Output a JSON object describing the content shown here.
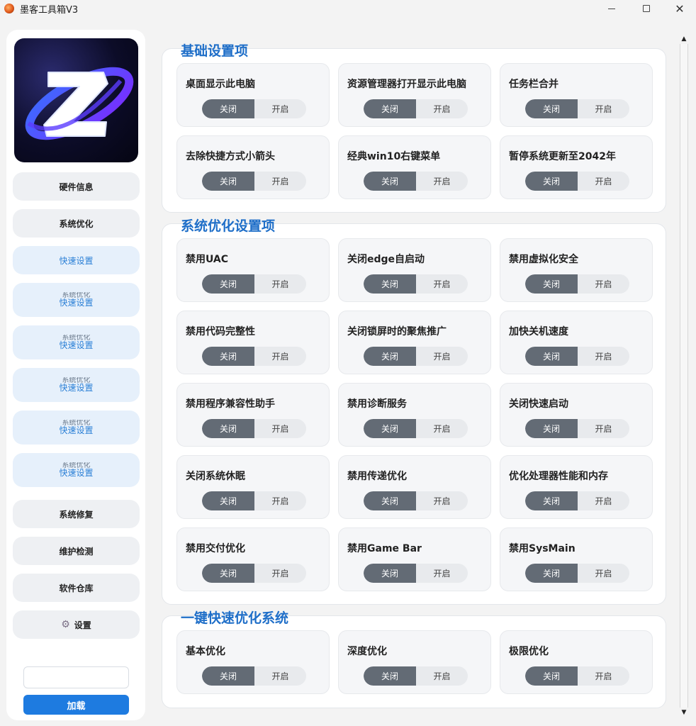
{
  "window": {
    "title": "墨客工具箱V3",
    "minimize_glyph": "",
    "close_glyph": "✕"
  },
  "sidebar": {
    "items": [
      {
        "label": "硬件信息"
      },
      {
        "label": "系统优化"
      },
      {
        "label": "快速设置"
      },
      {
        "label": "快速设置",
        "ghost": "系统优化"
      },
      {
        "label": "快速设置",
        "ghost": "系统优化"
      },
      {
        "label": "快速设置",
        "ghost": "系统优化"
      },
      {
        "label": "快速设置",
        "ghost": "系统优化"
      },
      {
        "label": "快速设置",
        "ghost": "系统优化"
      },
      {
        "label": "系统修复"
      },
      {
        "label": "维护检测"
      },
      {
        "label": "软件仓库"
      },
      {
        "label": "设置",
        "icon": "gear-icon"
      }
    ],
    "load_input": {
      "value": "",
      "placeholder": ""
    },
    "load_button": "加载"
  },
  "toggle": {
    "off_label": "关闭",
    "on_label": "开启",
    "selected": "off"
  },
  "sections": [
    {
      "title": "基础设置项",
      "cards": [
        "桌面显示此电脑",
        "资源管理器打开显示此电脑",
        "任务栏合并",
        "去除快捷方式小箭头",
        "经典win10右键菜单",
        "暂停系统更新至2042年"
      ]
    },
    {
      "title": "系统优化设置项",
      "cards": [
        "禁用UAC",
        "关闭edge自启动",
        "禁用虚拟化安全",
        "禁用代码完整性",
        "关闭锁屏时的聚焦推广",
        "加快关机速度",
        "禁用程序兼容性助手",
        "禁用诊断服务",
        "关闭快速启动",
        "关闭系统休眠",
        "禁用传递优化",
        "优化处理器性能和内存",
        "禁用交付优化",
        "禁用Game Bar",
        "禁用SysMain"
      ]
    },
    {
      "title": "一键快速优化系统",
      "cards": [
        "基本优化",
        "深度优化",
        "极限优化"
      ]
    }
  ],
  "colors": {
    "accent": "#1e6ec8",
    "button_blue": "#1e7be0",
    "toggle_off_bg": "#636b75"
  }
}
